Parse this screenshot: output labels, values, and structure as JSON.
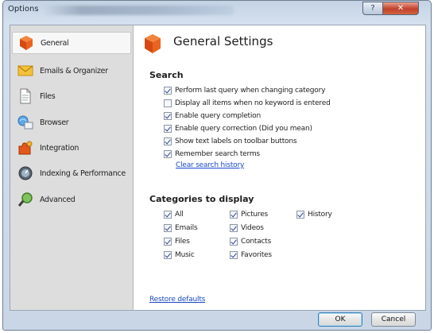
{
  "window": {
    "title": "Options",
    "help_glyph": "?",
    "close_glyph": "✕"
  },
  "sidebar": {
    "items": [
      {
        "label": "General",
        "icon": "general-cube-icon",
        "selected": true
      },
      {
        "label": "Emails & Organizer",
        "icon": "envelope-icon",
        "selected": false
      },
      {
        "label": "Files",
        "icon": "document-icon",
        "selected": false
      },
      {
        "label": "Browser",
        "icon": "browser-icon",
        "selected": false
      },
      {
        "label": "Integration",
        "icon": "puzzle-icon",
        "selected": false
      },
      {
        "label": "Indexing & Performance",
        "icon": "gauge-icon",
        "selected": false
      },
      {
        "label": "Advanced",
        "icon": "magnifier-icon",
        "selected": false
      }
    ]
  },
  "main": {
    "title": "General Settings",
    "search": {
      "heading": "Search",
      "options": [
        {
          "label": "Perform last query when changing category",
          "checked": true
        },
        {
          "label": "Display all items when no keyword is entered",
          "checked": false
        },
        {
          "label": "Enable query completion",
          "checked": true
        },
        {
          "label": "Enable query correction (Did you mean)",
          "checked": true
        },
        {
          "label": "Show text labels on toolbar buttons",
          "checked": true
        },
        {
          "label": "Remember search terms",
          "checked": true
        }
      ],
      "clear_link": "Clear search history"
    },
    "categories": {
      "heading": "Categories to display",
      "items": [
        {
          "label": "All",
          "checked": true
        },
        {
          "label": "Emails",
          "checked": true
        },
        {
          "label": "Files",
          "checked": true
        },
        {
          "label": "Music",
          "checked": true
        },
        {
          "label": "Pictures",
          "checked": true
        },
        {
          "label": "Videos",
          "checked": true
        },
        {
          "label": "Contacts",
          "checked": true
        },
        {
          "label": "Favorites",
          "checked": true
        },
        {
          "label": "History",
          "checked": true
        }
      ]
    },
    "restore_link": "Restore defaults"
  },
  "footer": {
    "ok_label": "OK",
    "cancel_label": "Cancel"
  },
  "colors": {
    "accent_orange": "#e8571e",
    "link_blue": "#1b49c8",
    "title_bar": "#c4d3e4"
  }
}
